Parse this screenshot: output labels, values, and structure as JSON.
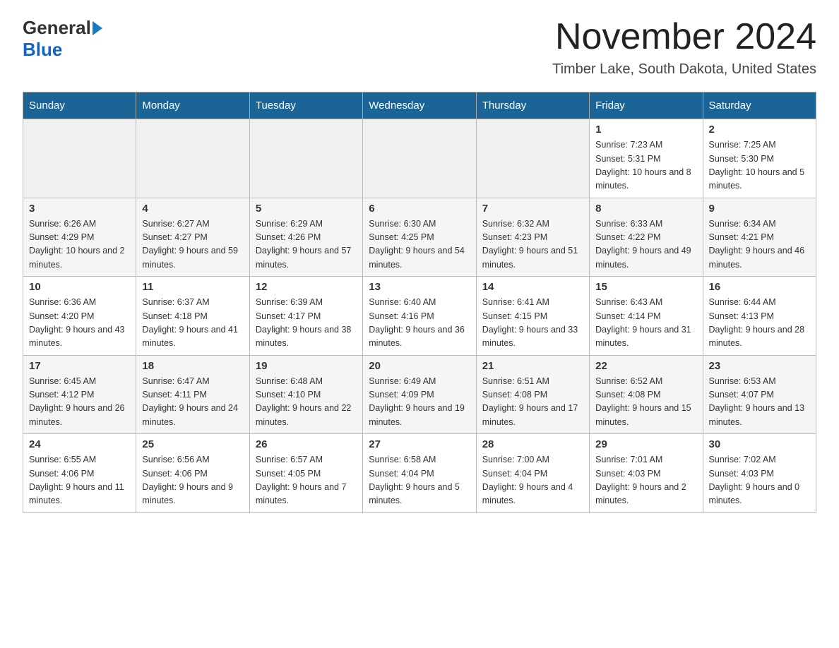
{
  "logo": {
    "general": "General",
    "blue": "Blue"
  },
  "title": {
    "month_year": "November 2024",
    "location": "Timber Lake, South Dakota, United States"
  },
  "days_of_week": [
    "Sunday",
    "Monday",
    "Tuesday",
    "Wednesday",
    "Thursday",
    "Friday",
    "Saturday"
  ],
  "weeks": [
    [
      {
        "day": "",
        "info": ""
      },
      {
        "day": "",
        "info": ""
      },
      {
        "day": "",
        "info": ""
      },
      {
        "day": "",
        "info": ""
      },
      {
        "day": "",
        "info": ""
      },
      {
        "day": "1",
        "info": "Sunrise: 7:23 AM\nSunset: 5:31 PM\nDaylight: 10 hours and 8 minutes."
      },
      {
        "day": "2",
        "info": "Sunrise: 7:25 AM\nSunset: 5:30 PM\nDaylight: 10 hours and 5 minutes."
      }
    ],
    [
      {
        "day": "3",
        "info": "Sunrise: 6:26 AM\nSunset: 4:29 PM\nDaylight: 10 hours and 2 minutes."
      },
      {
        "day": "4",
        "info": "Sunrise: 6:27 AM\nSunset: 4:27 PM\nDaylight: 9 hours and 59 minutes."
      },
      {
        "day": "5",
        "info": "Sunrise: 6:29 AM\nSunset: 4:26 PM\nDaylight: 9 hours and 57 minutes."
      },
      {
        "day": "6",
        "info": "Sunrise: 6:30 AM\nSunset: 4:25 PM\nDaylight: 9 hours and 54 minutes."
      },
      {
        "day": "7",
        "info": "Sunrise: 6:32 AM\nSunset: 4:23 PM\nDaylight: 9 hours and 51 minutes."
      },
      {
        "day": "8",
        "info": "Sunrise: 6:33 AM\nSunset: 4:22 PM\nDaylight: 9 hours and 49 minutes."
      },
      {
        "day": "9",
        "info": "Sunrise: 6:34 AM\nSunset: 4:21 PM\nDaylight: 9 hours and 46 minutes."
      }
    ],
    [
      {
        "day": "10",
        "info": "Sunrise: 6:36 AM\nSunset: 4:20 PM\nDaylight: 9 hours and 43 minutes."
      },
      {
        "day": "11",
        "info": "Sunrise: 6:37 AM\nSunset: 4:18 PM\nDaylight: 9 hours and 41 minutes."
      },
      {
        "day": "12",
        "info": "Sunrise: 6:39 AM\nSunset: 4:17 PM\nDaylight: 9 hours and 38 minutes."
      },
      {
        "day": "13",
        "info": "Sunrise: 6:40 AM\nSunset: 4:16 PM\nDaylight: 9 hours and 36 minutes."
      },
      {
        "day": "14",
        "info": "Sunrise: 6:41 AM\nSunset: 4:15 PM\nDaylight: 9 hours and 33 minutes."
      },
      {
        "day": "15",
        "info": "Sunrise: 6:43 AM\nSunset: 4:14 PM\nDaylight: 9 hours and 31 minutes."
      },
      {
        "day": "16",
        "info": "Sunrise: 6:44 AM\nSunset: 4:13 PM\nDaylight: 9 hours and 28 minutes."
      }
    ],
    [
      {
        "day": "17",
        "info": "Sunrise: 6:45 AM\nSunset: 4:12 PM\nDaylight: 9 hours and 26 minutes."
      },
      {
        "day": "18",
        "info": "Sunrise: 6:47 AM\nSunset: 4:11 PM\nDaylight: 9 hours and 24 minutes."
      },
      {
        "day": "19",
        "info": "Sunrise: 6:48 AM\nSunset: 4:10 PM\nDaylight: 9 hours and 22 minutes."
      },
      {
        "day": "20",
        "info": "Sunrise: 6:49 AM\nSunset: 4:09 PM\nDaylight: 9 hours and 19 minutes."
      },
      {
        "day": "21",
        "info": "Sunrise: 6:51 AM\nSunset: 4:08 PM\nDaylight: 9 hours and 17 minutes."
      },
      {
        "day": "22",
        "info": "Sunrise: 6:52 AM\nSunset: 4:08 PM\nDaylight: 9 hours and 15 minutes."
      },
      {
        "day": "23",
        "info": "Sunrise: 6:53 AM\nSunset: 4:07 PM\nDaylight: 9 hours and 13 minutes."
      }
    ],
    [
      {
        "day": "24",
        "info": "Sunrise: 6:55 AM\nSunset: 4:06 PM\nDaylight: 9 hours and 11 minutes."
      },
      {
        "day": "25",
        "info": "Sunrise: 6:56 AM\nSunset: 4:06 PM\nDaylight: 9 hours and 9 minutes."
      },
      {
        "day": "26",
        "info": "Sunrise: 6:57 AM\nSunset: 4:05 PM\nDaylight: 9 hours and 7 minutes."
      },
      {
        "day": "27",
        "info": "Sunrise: 6:58 AM\nSunset: 4:04 PM\nDaylight: 9 hours and 5 minutes."
      },
      {
        "day": "28",
        "info": "Sunrise: 7:00 AM\nSunset: 4:04 PM\nDaylight: 9 hours and 4 minutes."
      },
      {
        "day": "29",
        "info": "Sunrise: 7:01 AM\nSunset: 4:03 PM\nDaylight: 9 hours and 2 minutes."
      },
      {
        "day": "30",
        "info": "Sunrise: 7:02 AM\nSunset: 4:03 PM\nDaylight: 9 hours and 0 minutes."
      }
    ]
  ]
}
